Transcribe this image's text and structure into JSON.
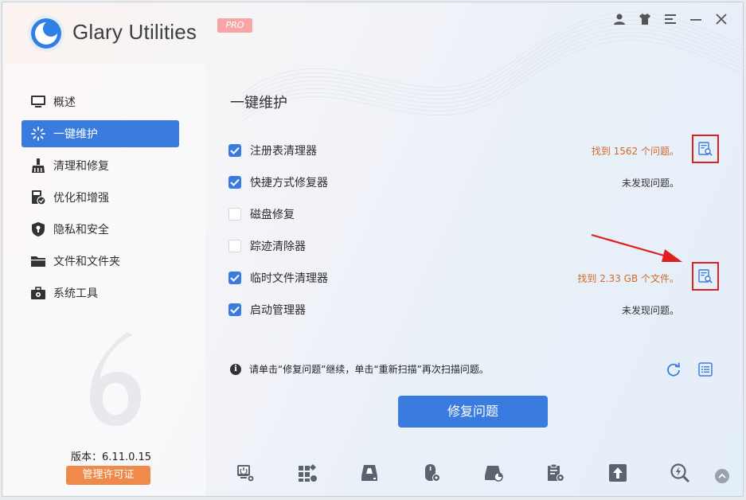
{
  "app": {
    "title": "Glary Utilities",
    "badge": "PRO",
    "accent_color": "#3a7be0"
  },
  "titlebar": {
    "icons": [
      "user-icon",
      "skin-icon",
      "menu-icon",
      "minimize-icon",
      "close-icon"
    ]
  },
  "sidebar": {
    "items": [
      {
        "label": "概述",
        "icon": "monitor-icon",
        "active": false
      },
      {
        "label": "一键维护",
        "icon": "sparkle-icon",
        "active": true
      },
      {
        "label": "清理和修复",
        "icon": "broom-icon",
        "active": false
      },
      {
        "label": "优化和增强",
        "icon": "optimize-icon",
        "active": false
      },
      {
        "label": "隐私和安全",
        "icon": "shield-icon",
        "active": false
      },
      {
        "label": "文件和文件夹",
        "icon": "folder-icon",
        "active": false
      },
      {
        "label": "系统工具",
        "icon": "toolbox-icon",
        "active": false
      }
    ],
    "version_label": "版本：",
    "version_value": "6.11.0.15",
    "license_button": "管理许可证"
  },
  "main": {
    "title": "一键维护",
    "items": [
      {
        "label": "注册表清理器",
        "checked": true,
        "status": "找到 1562 个问题。",
        "found": true,
        "has_detail": true
      },
      {
        "label": "快捷方式修复器",
        "checked": true,
        "status": "未发现问题。",
        "found": false,
        "has_detail": false
      },
      {
        "label": "磁盘修复",
        "checked": false,
        "status": "",
        "found": false,
        "has_detail": false
      },
      {
        "label": "踪迹清除器",
        "checked": false,
        "status": "",
        "found": false,
        "has_detail": false
      },
      {
        "label": "临时文件清理器",
        "checked": true,
        "status": "找到 2.33 GB 个文件。",
        "found": true,
        "has_detail": true
      },
      {
        "label": "启动管理器",
        "checked": true,
        "status": "未发现问题。",
        "found": false,
        "has_detail": false
      }
    ],
    "info_text": "请单击“修复问题”继续，单击“重新扫描”再次扫描问题。",
    "fix_button": "修复问题"
  },
  "bottom_toolbar": {
    "icons": [
      "screen-settings-icon",
      "apps-icon",
      "disk-cleaner-icon",
      "mouse-settings-icon",
      "disk-analyzer-icon",
      "clipboard-settings-icon",
      "upload-icon",
      "search-bolt-icon",
      "scroll-up-icon"
    ]
  }
}
